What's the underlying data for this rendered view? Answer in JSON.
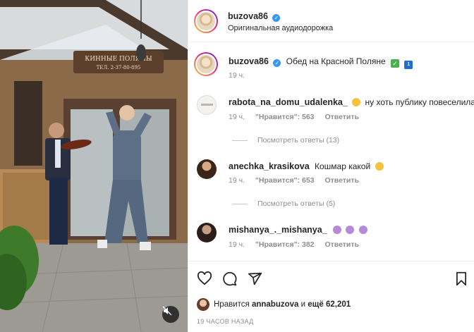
{
  "header": {
    "username": "buzova86",
    "audio": "Оригинальная аудиодорожка"
  },
  "caption": {
    "username": "buzova86",
    "text": "Обед на Красной Поляне",
    "time": "19 ч."
  },
  "comments": [
    {
      "username": "rabota_na_domu_udalenka_",
      "text": "ну хоть публику повеселила",
      "time": "19 ч.",
      "likes": "\"Нравится\": 563",
      "reply": "Ответить",
      "view_replies": "Посмотреть ответы (13)"
    },
    {
      "username": "anechka_krasikova",
      "text": "Кошмар какой",
      "time": "19 ч.",
      "likes": "\"Нравится\": 653",
      "reply": "Ответить",
      "view_replies": "Посмотреть ответы (5)"
    },
    {
      "username": "mishanya_._mishanya_",
      "text": "",
      "time": "19 ч.",
      "likes": "\"Нравится\": 382",
      "reply": "Ответить"
    }
  ],
  "likes_line": {
    "prefix": "Нравится",
    "user": "annabuzova",
    "middle": "и",
    "rest": "ещё 62,201"
  },
  "timestamp": "19 ЧАСОВ НАЗАД",
  "media": {
    "sign_text_1": "КИННЫЕ ПОЛЯНЫ",
    "sign_text_2": "ТЕЛ. 2-37-80-895"
  },
  "colors": {
    "verified": "#3897f0",
    "muted": "#8e8e8e",
    "text": "#262626"
  },
  "icons": [
    "heart-icon",
    "comment-icon",
    "share-icon",
    "bookmark-icon",
    "mute-icon",
    "verified-icon"
  ]
}
